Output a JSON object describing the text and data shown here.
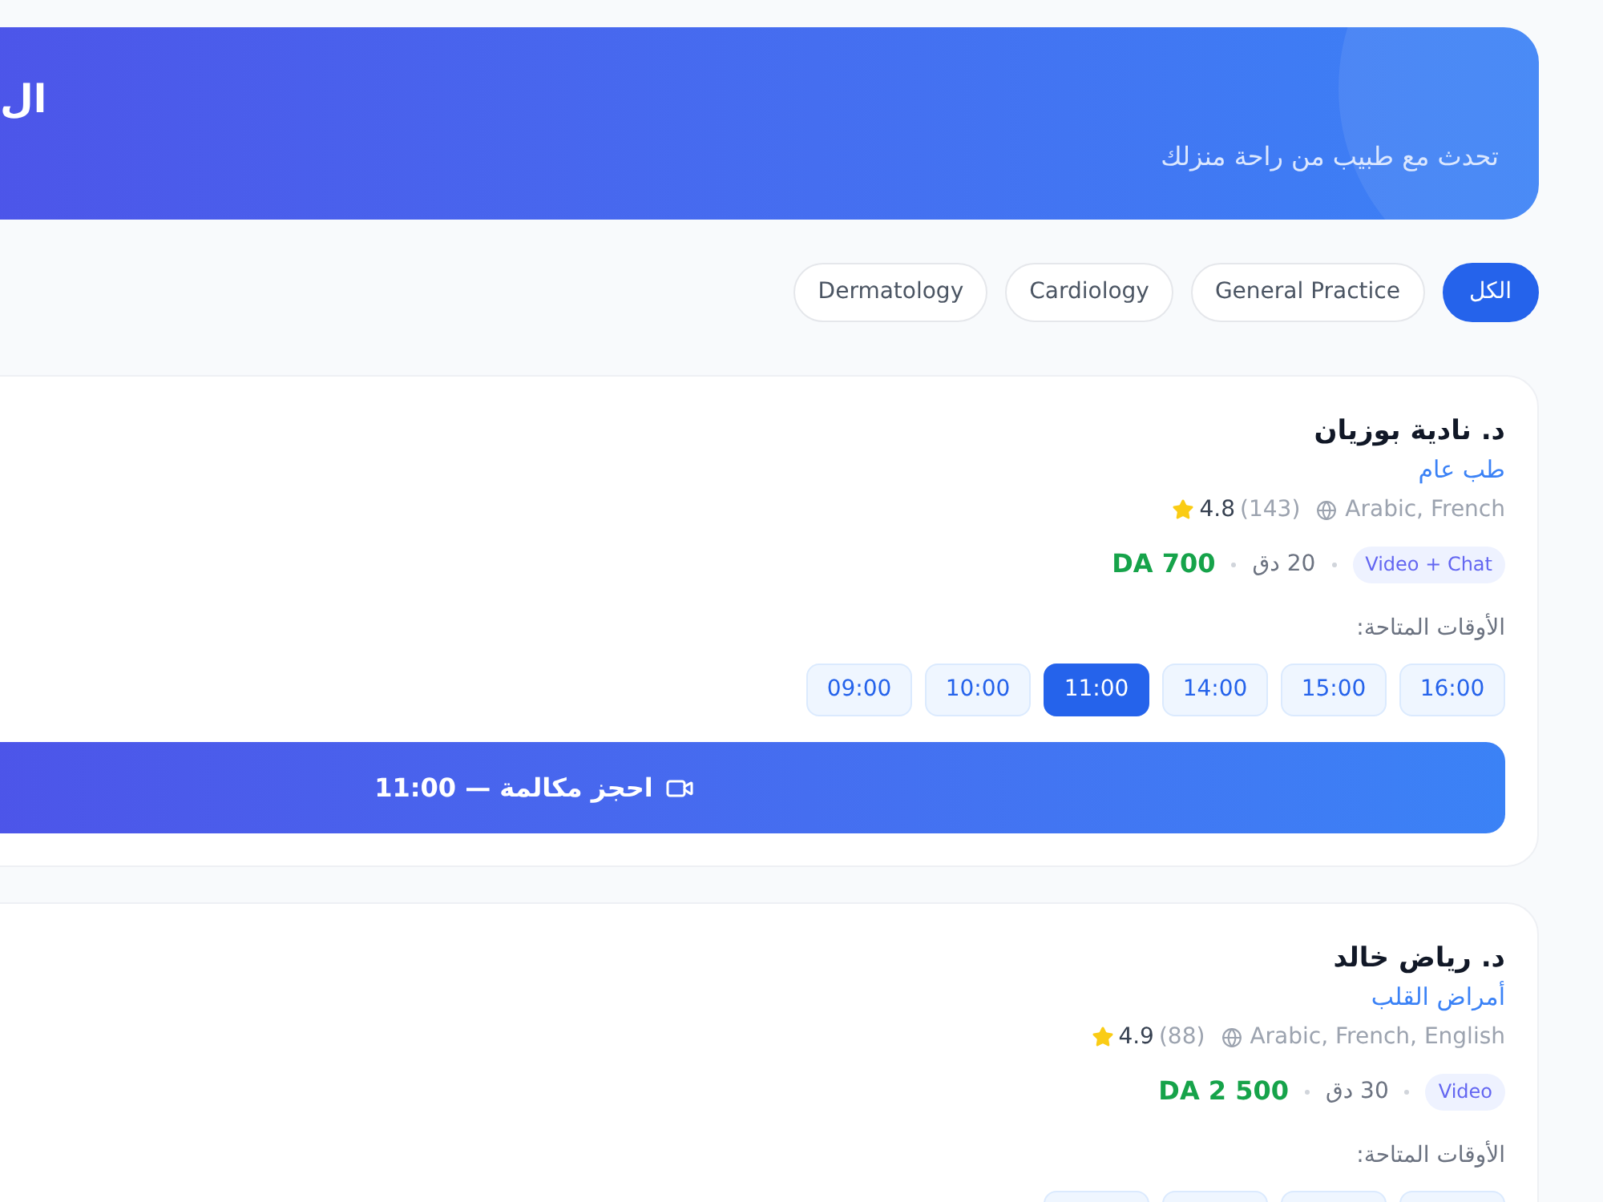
{
  "banner": {
    "title": "ال",
    "subtitle": "تحدث مع طبيب من راحة منزلك"
  },
  "filters": [
    {
      "label": "الكل",
      "selected": true
    },
    {
      "label": "General Practice",
      "selected": false
    },
    {
      "label": "Cardiology",
      "selected": false
    },
    {
      "label": "Dermatology",
      "selected": false
    }
  ],
  "doctors": [
    {
      "name": "د. نادية بوزيان",
      "specialty": "طب عام",
      "languages": "Arabic, French",
      "reviews": "(143)",
      "rating": "4.8",
      "mode": "Video + Chat",
      "duration": "20 دق",
      "price": "DA 700",
      "slots_label": "الأوقات المتاحة:",
      "slots": [
        {
          "time": "16:00",
          "selected": false
        },
        {
          "time": "15:00",
          "selected": false
        },
        {
          "time": "14:00",
          "selected": false
        },
        {
          "time": "11:00",
          "selected": true
        },
        {
          "time": "10:00",
          "selected": false
        },
        {
          "time": "09:00",
          "selected": false
        }
      ],
      "book_button": "احجز مكالمة — 11:00"
    },
    {
      "name": "د. رياض خالد",
      "specialty": "أمراض القلب",
      "languages": "Arabic, French, English",
      "reviews": "(88)",
      "rating": "4.9",
      "mode": "Video",
      "duration": "30 دق",
      "price": "DA 2 500",
      "slots_label": "الأوقات المتاحة:",
      "slots": [
        {
          "selected": false
        },
        {
          "selected": false
        },
        {
          "selected": false
        },
        {
          "selected": false
        }
      ]
    }
  ]
}
